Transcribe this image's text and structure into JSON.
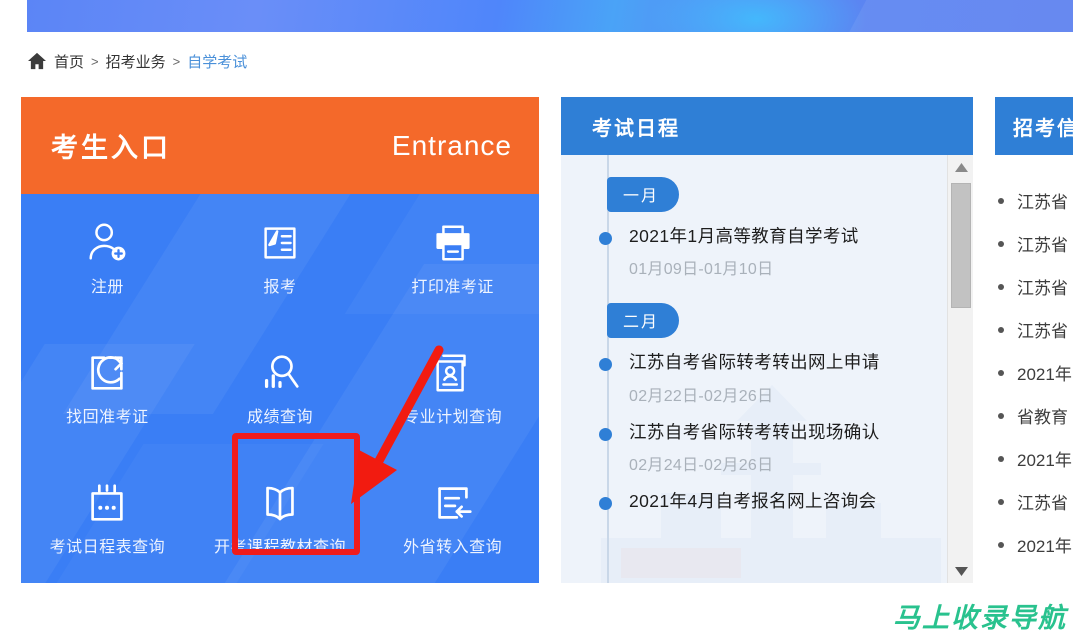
{
  "breadcrumb": {
    "home_icon": "home-icon",
    "items": [
      "首页",
      "招考业务",
      "自学考试"
    ],
    "separator": ">"
  },
  "entrance": {
    "title_cn": "考生入口",
    "title_en": "Entrance",
    "header_color": "#f4692a",
    "body_color": "#3a7ef5",
    "highlight_color": "#ef1c1c",
    "highlighted_item": "成绩查询",
    "items": [
      {
        "label": "注册",
        "icon": "user-add-icon"
      },
      {
        "label": "报考",
        "icon": "form-pen-icon"
      },
      {
        "label": "打印准考证",
        "icon": "printer-icon"
      },
      {
        "label": "找回准考证",
        "icon": "retrieve-card-icon"
      },
      {
        "label": "成绩查询",
        "icon": "score-search-icon"
      },
      {
        "label": "专业计划查询",
        "icon": "id-card-icon"
      },
      {
        "label": "考试日程表查询",
        "icon": "calendar-icon"
      },
      {
        "label": "开考课程教材查询",
        "icon": "book-icon"
      },
      {
        "label": "外省转入查询",
        "icon": "transfer-in-icon"
      }
    ]
  },
  "schedule": {
    "title": "考试日程",
    "header_color": "#2f7fd6",
    "groups": [
      {
        "month": "一月",
        "events": [
          {
            "title": "2021年1月高等教育自学考试",
            "date": "01月09日-01月10日"
          }
        ]
      },
      {
        "month": "二月",
        "events": [
          {
            "title": "江苏自考省际转考转出网上申请",
            "date": "02月22日-02月26日"
          },
          {
            "title": "江苏自考省际转考转出现场确认",
            "date": "02月24日-02月26日"
          },
          {
            "title": "2021年4月自考报名网上咨询会",
            "date": ""
          }
        ]
      }
    ],
    "scrollbar": {
      "up_arrow": "▲",
      "down_arrow": "▼"
    }
  },
  "news": {
    "title": "招考信",
    "header_color": "#2f7fd6",
    "items": [
      "江苏省",
      "江苏省",
      "江苏省",
      "江苏省",
      "2021年",
      "省教育",
      "2021年",
      "江苏省",
      "2021年"
    ]
  },
  "watermark": {
    "text": "马上收录导航",
    "color": "#29c28e"
  }
}
